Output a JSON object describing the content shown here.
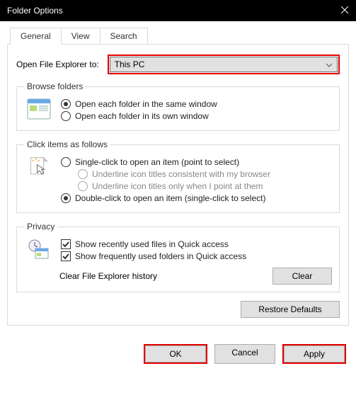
{
  "title": "Folder Options",
  "tabs": {
    "general": "General",
    "view": "View",
    "search": "Search"
  },
  "open": {
    "label": "Open File Explorer to:",
    "value": "This PC"
  },
  "browse": {
    "legend": "Browse folders",
    "same": "Open each folder in the same window",
    "own": "Open each folder in its own window"
  },
  "click": {
    "legend": "Click items as follows",
    "single": "Single-click to open an item (point to select)",
    "underline_browser": "Underline icon titles consistent with my browser",
    "underline_point": "Underline icon titles only when I point at them",
    "double": "Double-click to open an item (single-click to select)"
  },
  "privacy": {
    "legend": "Privacy",
    "recent_files": "Show recently used files in Quick access",
    "frequent_folders": "Show frequently used folders in Quick access",
    "clear_label": "Clear File Explorer history",
    "clear_btn": "Clear"
  },
  "restore": "Restore Defaults",
  "footer": {
    "ok": "OK",
    "cancel": "Cancel",
    "apply": "Apply"
  }
}
